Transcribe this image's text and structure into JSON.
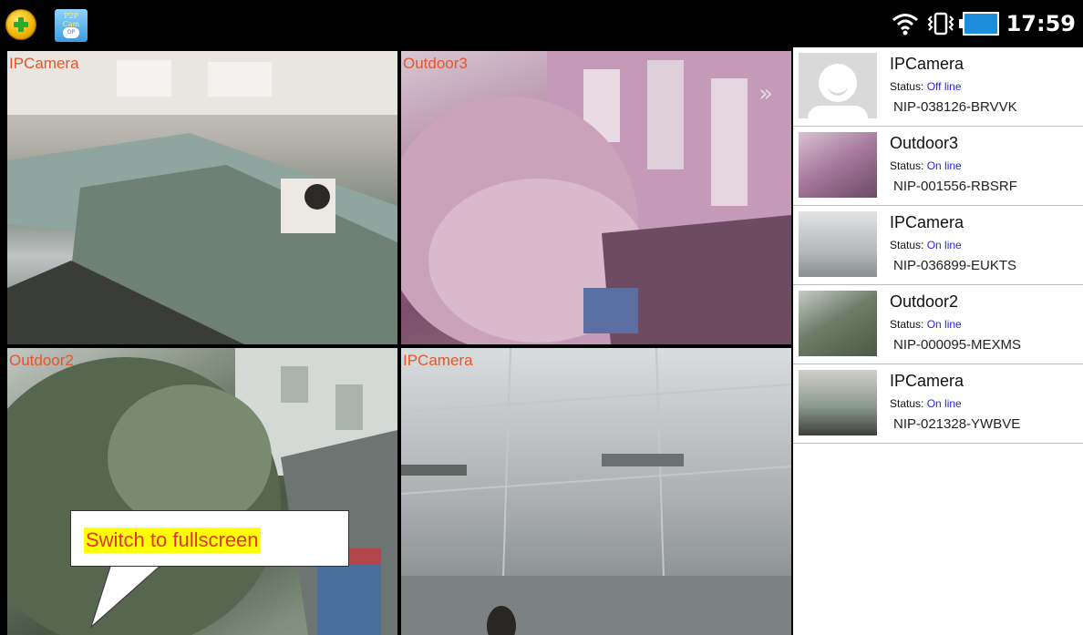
{
  "statusbar": {
    "app_icons": [
      {
        "icon": "add-app-icon"
      },
      {
        "icon": "p2p-cam-app-icon",
        "label_top": "P2P Cam",
        "label_bottom": "OP"
      }
    ],
    "clock": "17:59",
    "icons": [
      "wifi-icon",
      "vibrate-icon",
      "battery-icon"
    ]
  },
  "grid": {
    "tiles": [
      {
        "name": "IPCamera"
      },
      {
        "name": "Outdoor3"
      },
      {
        "name": "Outdoor2"
      },
      {
        "name": "IPCamera"
      }
    ],
    "next_icon": "double-chevron-right-icon"
  },
  "callout": {
    "text": "Switch to fullscreen"
  },
  "camera_list": {
    "status_label": "Status:",
    "items": [
      {
        "name": "IPCamera",
        "status": "Off line",
        "uid": "NIP-038126-BRVVK"
      },
      {
        "name": "Outdoor3",
        "status": "On line",
        "uid": "NIP-001556-RBSRF"
      },
      {
        "name": "IPCamera",
        "status": "On line",
        "uid": "NIP-036899-EUKTS"
      },
      {
        "name": "Outdoor2",
        "status": "On line",
        "uid": "NIP-000095-MEXMS"
      },
      {
        "name": "IPCamera",
        "status": "On line",
        "uid": "NIP-021328-YWBVE"
      }
    ]
  },
  "colors": {
    "camera_label": "#e2572b",
    "status_value": "#2727d6",
    "callout_text": "#e4322a",
    "callout_highlight": "#ffff00"
  }
}
